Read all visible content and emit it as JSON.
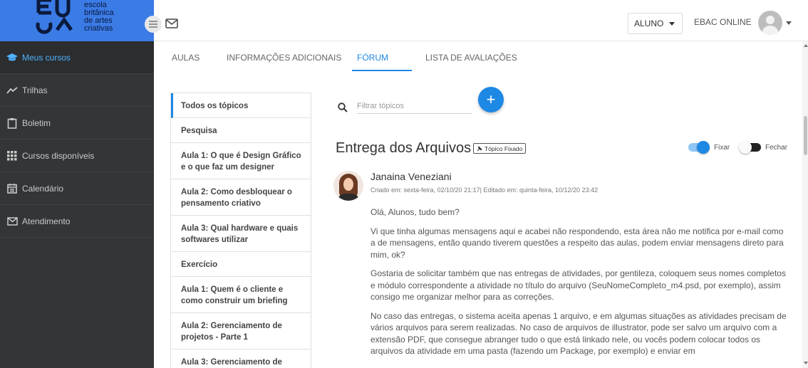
{
  "brand": {
    "mark": "EBAC",
    "words": [
      "escola",
      "britânica",
      "de artes",
      "criativas"
    ]
  },
  "header": {
    "role_select": "ALUNO",
    "ebac_online": "EBAC ONLINE",
    "icons": [
      "menu-icon",
      "mail-icon",
      "avatar-icon",
      "chevron-down-icon"
    ]
  },
  "sidebar": {
    "items": [
      {
        "label": "Meus cursos",
        "icon": "graduation-cap-icon",
        "active": true
      },
      {
        "label": "Trilhas",
        "icon": "trend-line-icon",
        "active": false
      },
      {
        "label": "Boletim",
        "icon": "clipboard-icon",
        "active": false
      },
      {
        "label": "Cursos disponíveis",
        "icon": "grid-icon",
        "active": false
      },
      {
        "label": "Calendário",
        "icon": "calendar-icon",
        "active": false
      },
      {
        "label": "Atendimento",
        "icon": "mail-icon",
        "active": false
      }
    ]
  },
  "tabs": [
    {
      "label": "AULAS",
      "active": false
    },
    {
      "label": "INFORMAÇÕES ADICIONAIS",
      "active": false
    },
    {
      "label": "FÓRUM",
      "active": true
    },
    {
      "label": "LISTA DE AVALIAÇÕES",
      "active": false
    }
  ],
  "topics": [
    "Todos os tópicos",
    "Pesquisa",
    "Aula 1: O que é Design Gráfico e o que faz um designer",
    "Aula 2: Como desbloquear o pensamento criativo",
    "Aula 3: Qual hardware e quais softwares utilizar",
    "Exercício",
    "Aula 1: Quem é o cliente e como construir um briefing",
    "Aula 2: Gerenciamento de projetos - Parte 1",
    "Aula 3: Gerenciamento de"
  ],
  "filter": {
    "placeholder": "Filtrar tópicos",
    "add_label": "+"
  },
  "topic": {
    "title": "Entrega dos Arquivos",
    "pinned_badge": "Tópico Fixado",
    "toggle_fixar_label": "Fixar",
    "toggle_fixar_on": true,
    "toggle_fechar_label": "Fechar",
    "toggle_fechar_on": false
  },
  "post": {
    "author": "Janaina Veneziani",
    "meta": "Criado em: sexta-feira, 02/10/20 21:17| Editado em: quinta-feira, 10/12/20 23:42",
    "paragraphs": [
      "Olá, Alunos, tudo bem?",
      "Vi que tinha algumas mensagens aqui e acabei não respondendo, esta área não me notifica por e-mail como a de mensagens, então quando tiverem questões a respeito das aulas, podem enviar mensagens direto para mim, ok?",
      "Gostaria de solicitar também que nas entregas de atividades, por gentileza, coloquem seus nomes completos e módulo correspondente a atividade no título do arquivo (SeuNomeCompleto_m4.psd, por exemplo), assim consigo me organizar melhor para as correções.",
      "No caso das entregas, o sistema aceita apenas 1 arquivo, e em algumas situações as atividades precisam de vários arquivos para serem realizadas. No caso de arquivos de illustrator, pode ser salvo um arquivo com a extensão PDF, que consegue abranger tudo o que está linkado nele, ou vocês podem colocar todos os arquivos da atividade em uma pasta (fazendo um Package, por exemplo) e enviar em"
    ]
  },
  "colors": {
    "accent": "#1e88e5",
    "sidebar_bg": "#333638",
    "logo_bg": "#3b7be6"
  }
}
